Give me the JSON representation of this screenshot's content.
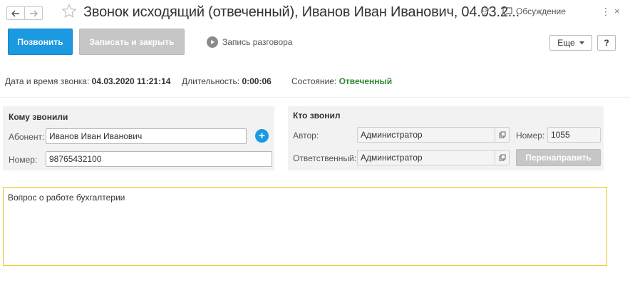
{
  "window": {
    "title": "Звонок исходящий (отвеченный), Иванов Иван Иванович, 04.03.2...",
    "discussion_label": "Обсуждение",
    "more_dots": "⋮",
    "close": "×"
  },
  "toolbar": {
    "call_label": "Позвонить",
    "save_close_label": "Записать и закрыть",
    "recording_label": "Запись разговора",
    "more_label": "Еще",
    "help_label": "?"
  },
  "info": {
    "datetime_label": "Дата и время звонка:",
    "datetime_value": "04.03.2020 11:21:14",
    "duration_label": "Длительность:",
    "duration_value": "0:00:06",
    "state_label": "Состояние:",
    "state_value": "Отвеченный"
  },
  "callee": {
    "title": "Кому звонили",
    "subscriber_label": "Абонент:",
    "subscriber_value": "Иванов Иван Иванович",
    "number_label": "Номер:",
    "number_value": "98765432100"
  },
  "caller": {
    "title": "Кто звонил",
    "author_label": "Автор:",
    "author_value": "Администратор",
    "number_label": "Номер:",
    "number_value": "1055",
    "responsible_label": "Ответственный:",
    "responsible_value": "Администратор",
    "redirect_label": "Перенаправить"
  },
  "comment": {
    "text": "Вопрос о работе бухгалтерии"
  },
  "colors": {
    "primary": "#1b9ae2",
    "disabled": "#c6c6c6",
    "success": "#2e8b2e",
    "focus_border": "#f0c419"
  }
}
